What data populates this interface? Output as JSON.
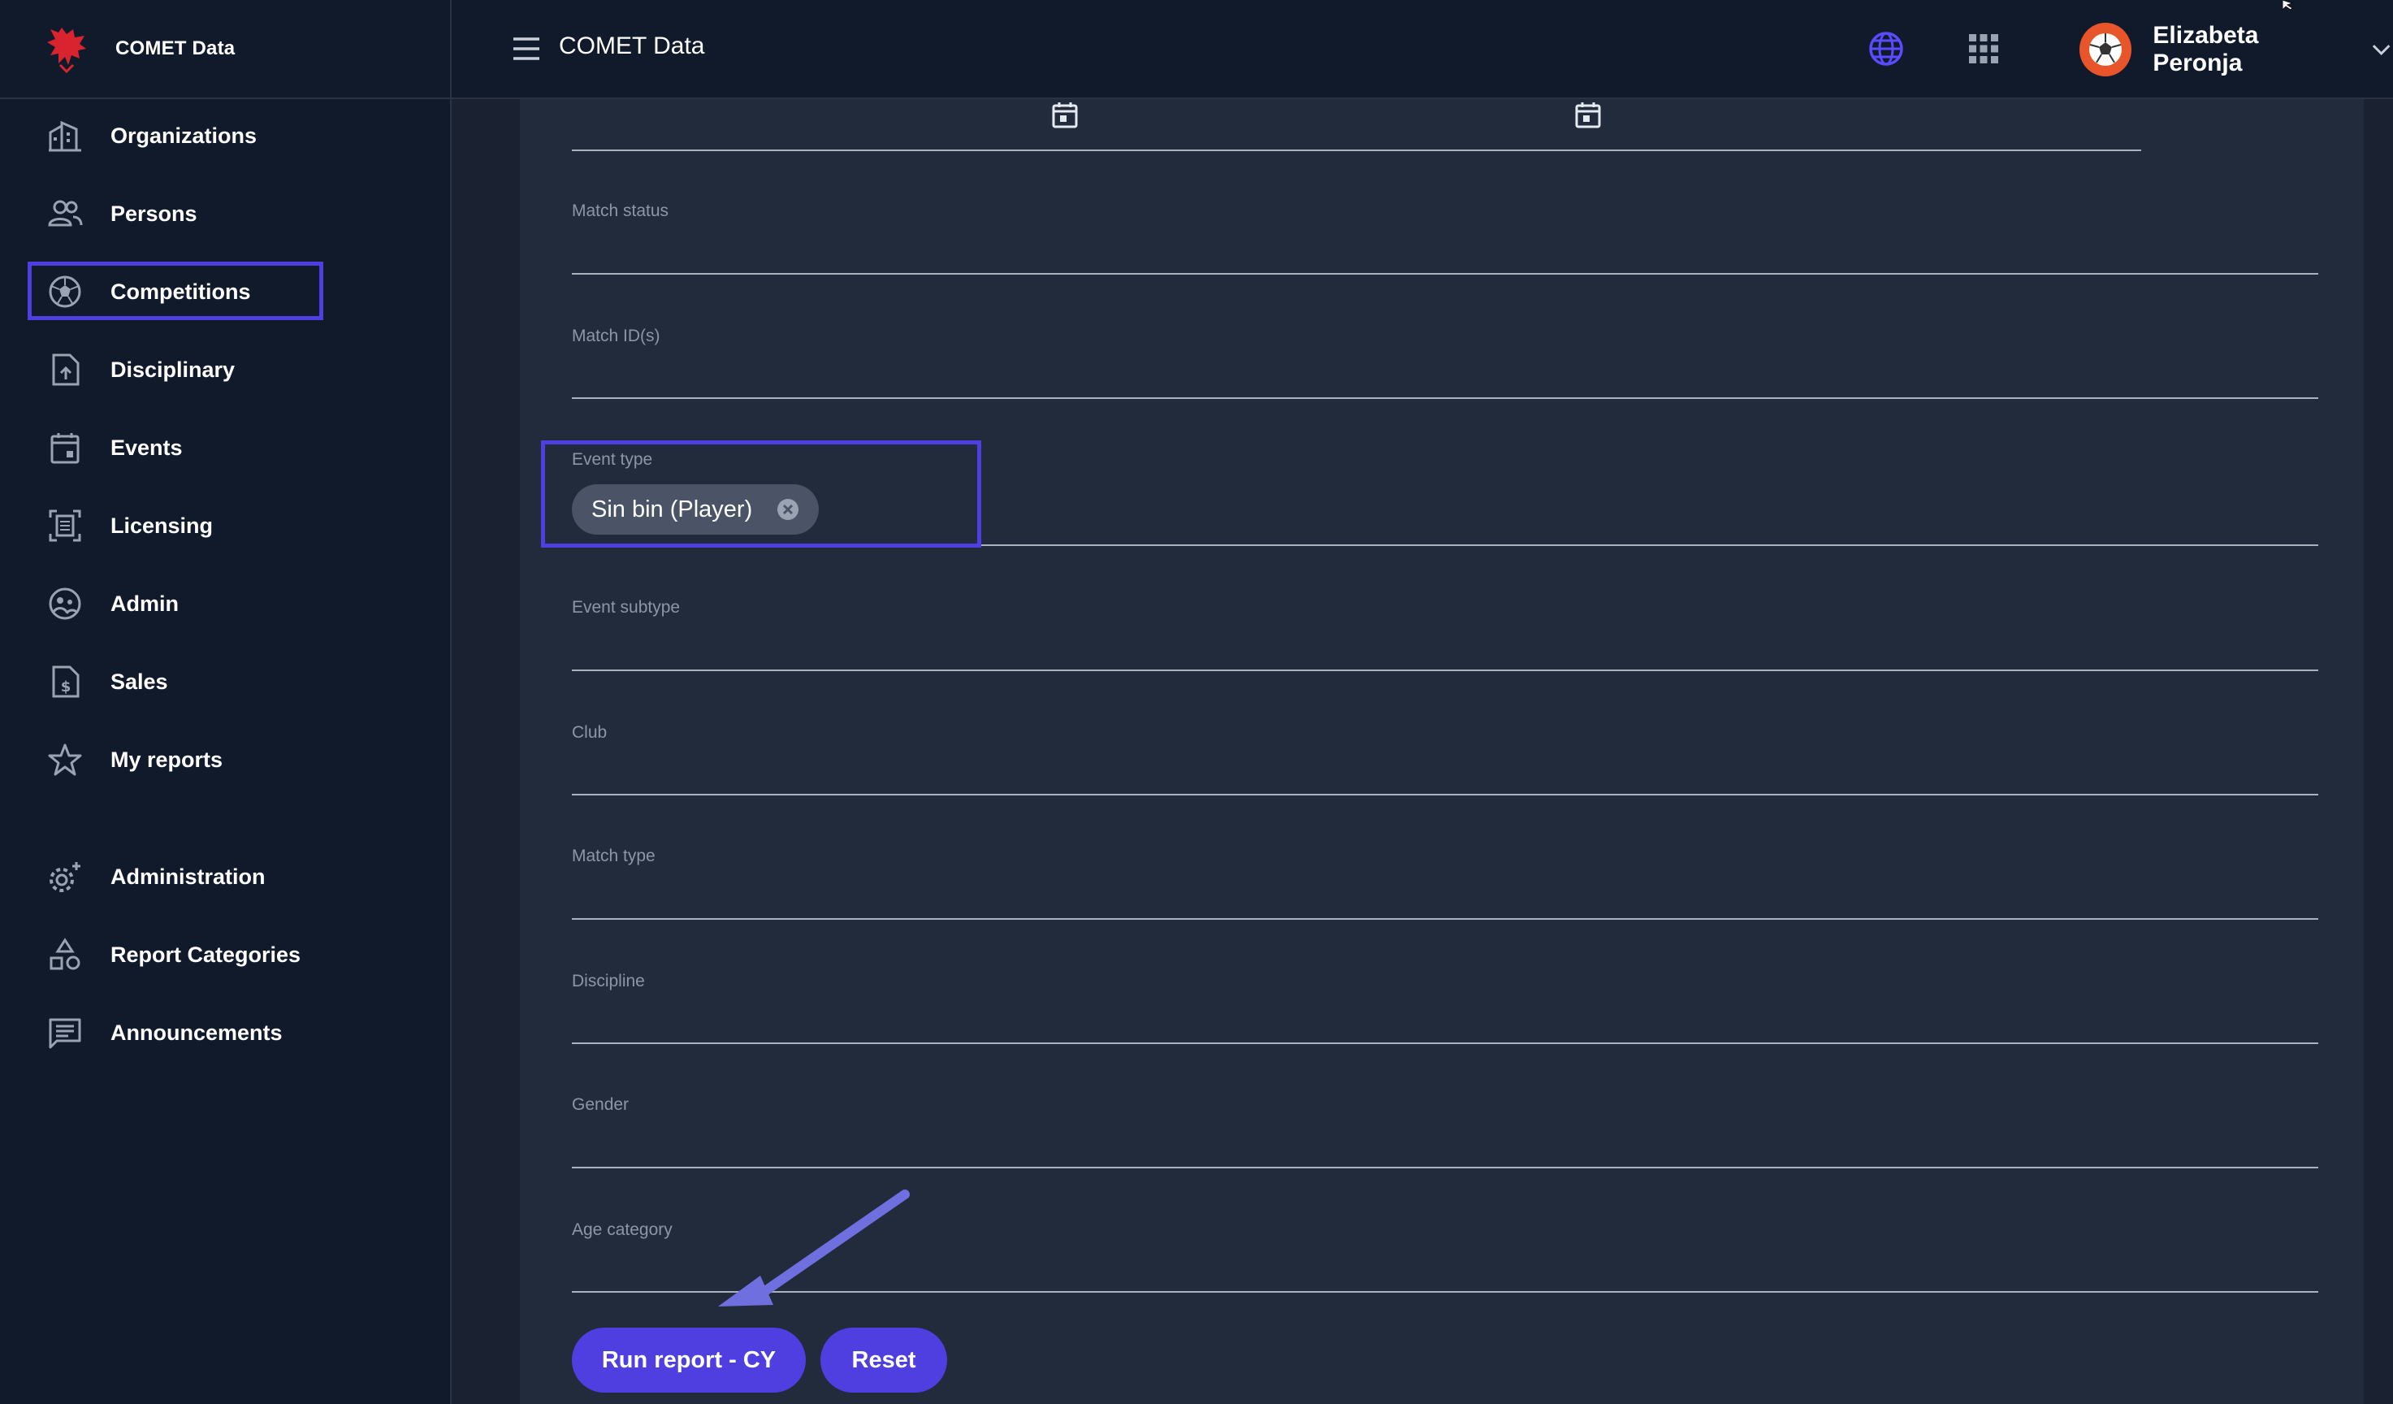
{
  "brand": {
    "title": "COMET Data"
  },
  "sidebar": {
    "items": [
      {
        "label": "Organizations",
        "icon": "organizations-icon"
      },
      {
        "label": "Persons",
        "icon": "persons-icon"
      },
      {
        "label": "Competitions",
        "icon": "competitions-icon"
      },
      {
        "label": "Disciplinary",
        "icon": "disciplinary-icon"
      },
      {
        "label": "Events",
        "icon": "events-icon"
      },
      {
        "label": "Licensing",
        "icon": "licensing-icon"
      },
      {
        "label": "Admin",
        "icon": "admin-icon"
      },
      {
        "label": "Sales",
        "icon": "sales-icon"
      },
      {
        "label": "My reports",
        "icon": "star-icon"
      },
      {
        "label": "Administration",
        "icon": "gear-icon"
      },
      {
        "label": "Report Categories",
        "icon": "categories-icon"
      },
      {
        "label": "Announcements",
        "icon": "announcements-icon"
      }
    ]
  },
  "topbar": {
    "title": "COMET Data",
    "user_name": "Elizabeta Peronja"
  },
  "form": {
    "fields": {
      "match_status": {
        "label": "Match status",
        "value": ""
      },
      "match_ids": {
        "label": "Match ID(s)",
        "value": ""
      },
      "event_type": {
        "label": "Event type",
        "chip": "Sin bin (Player)"
      },
      "event_subtype": {
        "label": "Event subtype",
        "value": ""
      },
      "club": {
        "label": "Club",
        "value": ""
      },
      "match_type": {
        "label": "Match type",
        "value": ""
      },
      "discipline": {
        "label": "Discipline",
        "value": ""
      },
      "gender": {
        "label": "Gender",
        "value": ""
      },
      "age_category": {
        "label": "Age category",
        "value": ""
      }
    },
    "run_label": "Run report - CY",
    "reset_label": "Reset"
  },
  "colors": {
    "accent": "#4f3ee0",
    "background": "#1a2232",
    "panel": "#222b3c",
    "sidebar": "#111a2b",
    "avatar": "#e8552a"
  }
}
